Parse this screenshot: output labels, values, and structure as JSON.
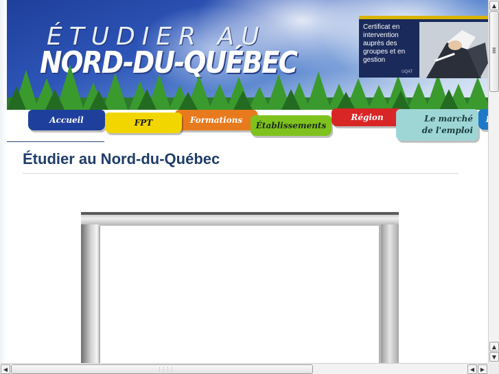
{
  "banner": {
    "title_top": "ÉTUDIER AU",
    "title_main": "NORD-DU-QUÉBEC"
  },
  "ad": {
    "text": "Certificat en intervention auprès des groupes et en gestion",
    "sub": "UQAT"
  },
  "nav": {
    "items": [
      {
        "label": "Accueil",
        "color": "#1e3f9c"
      },
      {
        "label": "FPT",
        "color": "#f2d600"
      },
      {
        "label": "Formations",
        "color": "#e87a1e"
      },
      {
        "label": "Établissements",
        "color": "#7fc21e"
      },
      {
        "label": "Région",
        "color": "#d82626"
      },
      {
        "label": "Le marché de l'emploi",
        "color": "#9ed6d6"
      },
      {
        "label": "F",
        "color": "#1e78c8"
      }
    ]
  },
  "main": {
    "page_title": "Étudier au Nord-du-Québec"
  },
  "scrollbars": {
    "up_icon": "arrow-up-icon",
    "down_icon": "arrow-down-icon",
    "left_icon": "arrow-left-icon",
    "right_icon": "arrow-right-icon"
  }
}
